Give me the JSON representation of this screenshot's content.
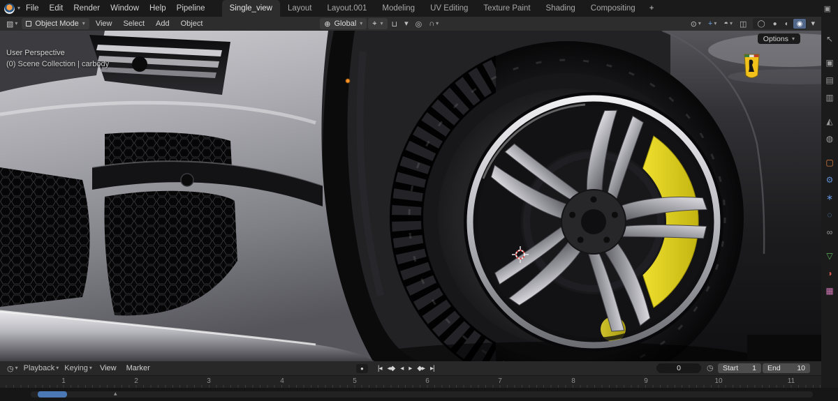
{
  "topbar": {
    "menus": [
      "File",
      "Edit",
      "Render",
      "Window",
      "Help",
      "Pipeline"
    ],
    "tabs": [
      "Single_view",
      "Layout",
      "Layout.001",
      "Modeling",
      "UV Editing",
      "Texture Paint",
      "Shading",
      "Compositing"
    ],
    "add_tab": "+"
  },
  "header": {
    "mode": "Object Mode",
    "menus": [
      "View",
      "Select",
      "Add",
      "Object"
    ],
    "orientation": "Global",
    "options": "Options"
  },
  "viewport": {
    "perspective": "User Perspective",
    "collection": "(0) Scene Collection | carbody"
  },
  "timeline": {
    "menus": [
      "Playback",
      "Keying",
      "View",
      "Marker"
    ],
    "transport": [
      "|◂",
      "◂◆",
      "◂",
      "▸",
      "◆▸",
      "▸|"
    ],
    "frame": "0",
    "start_label": "Start",
    "start_value": "1",
    "end_label": "End",
    "end_value": "10",
    "ruler": [
      "1",
      "2",
      "3",
      "4",
      "5",
      "6",
      "7",
      "8",
      "9",
      "10",
      "11"
    ]
  },
  "props": {
    "tabs": [
      {
        "name": "tool",
        "glyph": "↖",
        "style": "color:#9b9b9b"
      },
      {
        "name": "render",
        "glyph": "▣",
        "style": "color:#9b9b9b"
      },
      {
        "name": "output",
        "glyph": "▤",
        "style": "color:#9b9b9b"
      },
      {
        "name": "view-layer",
        "glyph": "▥",
        "style": "color:#9b9b9b"
      },
      {
        "name": "scene",
        "glyph": "◭",
        "style": "color:#9b9b9b"
      },
      {
        "name": "world",
        "glyph": "◍",
        "style": "color:#9b9b9b"
      },
      {
        "name": "object",
        "glyph": "▢",
        "style": "color:#e0813f"
      },
      {
        "name": "modifiers",
        "glyph": "⚙",
        "style": "color:#5f8fd4"
      },
      {
        "name": "particles",
        "glyph": "∗",
        "style": "color:#5f8fd4"
      },
      {
        "name": "physics",
        "glyph": "◌",
        "style": "color:#5f8fd4"
      },
      {
        "name": "constraints",
        "glyph": "∞",
        "style": "color:#9b9b9b"
      },
      {
        "name": "data",
        "glyph": "▽",
        "style": "color:#58b658"
      },
      {
        "name": "material",
        "glyph": "◑",
        "style": "color:#cf5a50"
      },
      {
        "name": "texture",
        "glyph": "▦",
        "style": "color:#d077b5"
      }
    ]
  },
  "icons": {
    "chevron_down": "▾",
    "chevron_up": "▴",
    "editor_3d": "▧",
    "globe": "⊕",
    "pivot": "⌖",
    "magnet": "⊔",
    "proportional": "◎",
    "falloff": "∩",
    "visibility": "⊙",
    "gizmos": "+",
    "overlays": "◓",
    "xray": "◫",
    "shade_wire": "◯",
    "shade_solid": "●",
    "shade_material": "◐",
    "shade_rendered": "◉",
    "clock": "◷",
    "record": "●",
    "monitor": "▣"
  },
  "colors": {
    "accent_blue": "#4b79b6",
    "caliper_yellow": "#e8d825",
    "badge_yellow": "#f2c21a",
    "object_orange": "#e0813f",
    "modifier_blue": "#5f8fd4",
    "data_green": "#58b658",
    "material_red": "#cf5a50",
    "texture_pink": "#d077b5",
    "cursor_red": "#d94444"
  }
}
